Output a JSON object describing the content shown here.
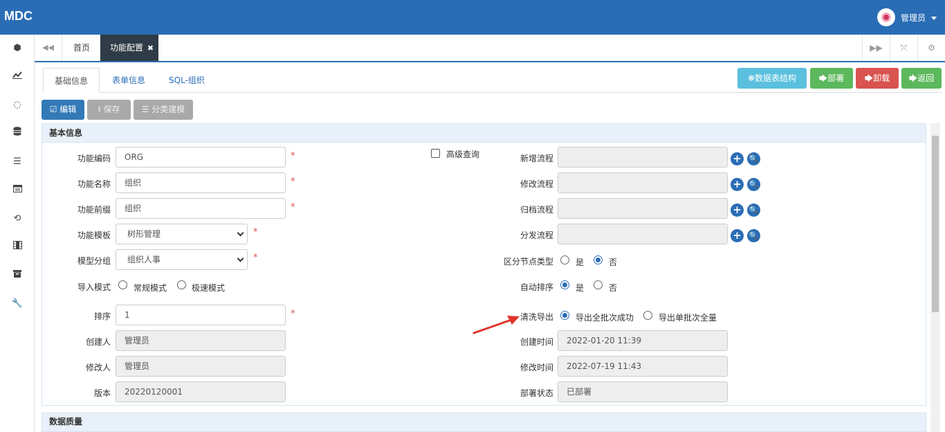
{
  "app": {
    "title": "MDC",
    "user": "管理员"
  },
  "tabs": {
    "home": "首页",
    "active": "功能配置",
    "close": "✖"
  },
  "subtabs": [
    "基础信息",
    "表单信息",
    "SQL-组织"
  ],
  "actions": {
    "structure": "❋数据表结构",
    "deploy": "🡆部署",
    "uninstall": "🡆卸载",
    "back": "🡆返回"
  },
  "toolbar": {
    "edit": "编辑",
    "save": "保存",
    "classify": "分类建模"
  },
  "panel": {
    "title": "基本信息",
    "next_title": "数据质量"
  },
  "form": {
    "code": {
      "label": "功能编码",
      "value": "ORG"
    },
    "name": {
      "label": "功能名称",
      "value": "组织"
    },
    "prefix": {
      "label": "功能前缀",
      "value": "组织"
    },
    "template": {
      "label": "功能模板",
      "value": "树形管理"
    },
    "group": {
      "label": "模型分组",
      "value": "组织人事"
    },
    "import_mode": {
      "label": "导入模式",
      "options": [
        "常规模式",
        "极速模式"
      ]
    },
    "sort": {
      "label": "排序",
      "value": "1"
    },
    "creator": {
      "label": "创建人",
      "value": "管理员"
    },
    "modifier": {
      "label": "修改人",
      "value": "管理员"
    },
    "version": {
      "label": "版本",
      "value": "20220120001"
    },
    "advanced": {
      "label": "高级查询"
    },
    "add_flow": {
      "label": "新增流程"
    },
    "edit_flow": {
      "label": "修改流程"
    },
    "archive_flow": {
      "label": "归档流程"
    },
    "dist_flow": {
      "label": "分发流程"
    },
    "node_type": {
      "label": "区分节点类型",
      "options": [
        "是",
        "否"
      ]
    },
    "auto_sort": {
      "label": "自动排序",
      "options": [
        "是",
        "否"
      ]
    },
    "clean_export": {
      "label": "清洗导出",
      "options": [
        "导出全批次成功",
        "导出单批次全量"
      ]
    },
    "created": {
      "label": "创建时间",
      "value": "2022-01-20 11:39"
    },
    "modified": {
      "label": "修改时间",
      "value": "2022-07-19 11:43"
    },
    "deploy_status": {
      "label": "部署状态",
      "value": "已部署"
    },
    "required_mark": "*"
  },
  "colors": {
    "brand": "#2a6db5",
    "info": "#5bc0de",
    "success": "#5cb85c",
    "danger": "#d9534f",
    "arrow": "#e0352b"
  }
}
